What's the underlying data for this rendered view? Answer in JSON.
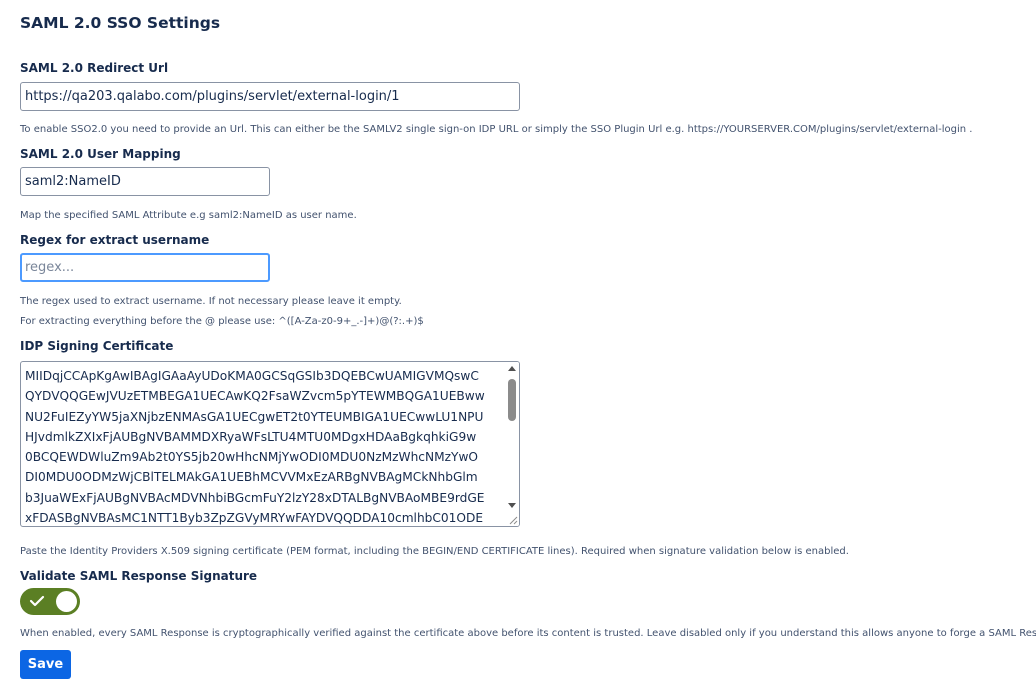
{
  "page": {
    "title": "SAML 2.0 SSO Settings"
  },
  "redirect_url": {
    "label": "SAML 2.0 Redirect Url",
    "value": "https://qa203.qalabo.com/plugins/servlet/external-login/1",
    "help": "To enable SSO2.0 you need to provide an Url. This can either be the SAMLV2 single sign-on IDP URL or simply the SSO Plugin Url e.g. https://YOURSERVER.COM/plugins/servlet/external-login ."
  },
  "user_mapping": {
    "label": "SAML 2.0 User Mapping",
    "value": "saml2:NameID",
    "help": "Map the specified SAML Attribute e.g saml2:NameID as user name."
  },
  "regex": {
    "label": "Regex for extract username",
    "value": "",
    "placeholder": "regex...",
    "help_line1": "The regex used to extract username. If not necessary please leave it empty.",
    "help_line2": "For extracting everything before the @ please use: ^([A-Za-z0-9+_.-]+)@(?:.+)$"
  },
  "certificate": {
    "label": "IDP Signing Certificate",
    "value": "MIIDqjCCApKgAwIBAgIGAaAyUDoKMA0GCSqGSIb3DQEBCwUAMIGVMQswC\nQYDVQQGEwJVUzETMBEGA1UECAwKQ2FsaWZvcm5pYTEWMBQGA1UEBww\nNU2FuIEZyYW5jaXNjbzENMAsGA1UECgwET2t0YTEUMBIGA1UECwwLU1NPU\nHJvdmlkZXIxFjAUBgNVBAMMDXRyaWFsLTU4MTU0MDgxHDAaBgkqhkiG9w\n0BCQEWDWluZm9Ab2t0YS5jb20wHhcNMjYwODI0MDU0NzMzWhcNMzYwO\nDI0MDU0ODMzWjCBlTELMAkGA1UEBhMCVVMxEzARBgNVBAgMCkNhbGlm\nb3JuaWExFjAUBgNVBAcMDVNhbiBGcmFuY2lzY28xDTALBgNVBAoMBE9rdGE\nxFDASBgNVBAsMC1NTT1Byb3ZpZGVyMRYwFAYDVQQDDA10cmlhbC01ODE",
    "help": "Paste the Identity Providers X.509 signing certificate (PEM format, including the BEGIN/END CERTIFICATE lines). Required when signature validation below is enabled."
  },
  "validate_signature": {
    "label": "Validate SAML Response Signature",
    "enabled": true,
    "help": "When enabled, every SAML Response is cryptographically verified against the certificate above before its content is trusted. Leave disabled only if you understand this allows anyone to forge a SAML Response."
  },
  "actions": {
    "save_label": "Save"
  },
  "colors": {
    "toggle_on": "#5b7f24",
    "primary_button": "#0c66e4",
    "focus_ring": "#4c9aff",
    "text": "#172b4d",
    "help_text": "#42526e"
  }
}
